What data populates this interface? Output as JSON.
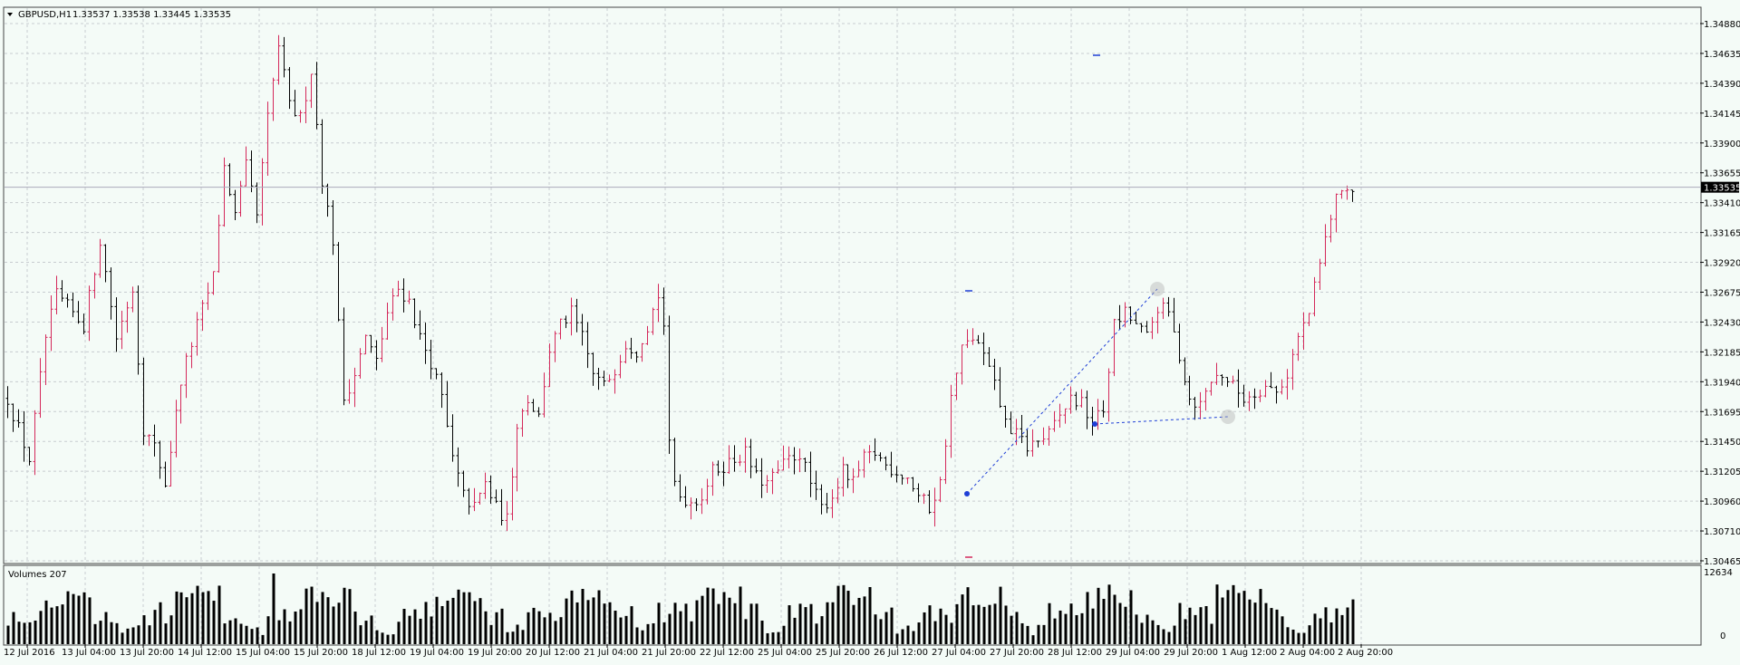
{
  "window": {
    "symbol_title": "GBPUSD,H1",
    "ohlc_text": "1.33537 1.33538 1.33445 1.33535",
    "menu_icon": "triangle-down-icon"
  },
  "colors": {
    "background": "#f4fbf7",
    "grid": "#c7ccd0",
    "bull_bar": "#d4285a",
    "bear_bar": "#000000",
    "volume_bar": "#000000",
    "trendline": "#1f3fd6",
    "current_price_bg": "#000000",
    "current_price_fg": "#ffffff"
  },
  "chart_data": [
    {
      "type": "bar",
      "subtype": "ohlc",
      "symbol": "GBPUSD",
      "timeframe": "H1",
      "ylim": [
        1.30465,
        1.3494
      ],
      "y_ticks": [
        "1.34880",
        "1.34635",
        "1.34390",
        "1.34145",
        "1.33900",
        "1.33655",
        "1.33410",
        "1.33165",
        "1.32920",
        "1.32675",
        "1.32430",
        "1.32185",
        "1.31940",
        "1.31695",
        "1.31450",
        "1.31205",
        "1.30960",
        "1.30710",
        "1.30465"
      ],
      "current_price": "1.33535",
      "x_labels": [
        "12 Jul 2016",
        "13 Jul 04:00",
        "13 Jul 20:00",
        "14 Jul 12:00",
        "15 Jul 04:00",
        "15 Jul 20:00",
        "18 Jul 12:00",
        "19 Jul 04:00",
        "19 Jul 20:00",
        "20 Jul 12:00",
        "21 Jul 04:00",
        "21 Jul 20:00",
        "22 Jul 12:00",
        "25 Jul 04:00",
        "25 Jul 20:00",
        "26 Jul 12:00",
        "27 Jul 04:00",
        "27 Jul 20:00",
        "28 Jul 12:00",
        "29 Jul 04:00",
        "29 Jul 20:00",
        "1 Aug 12:00",
        "2 Aug 04:00",
        "2 Aug 20:00"
      ],
      "price_path": [
        [
          0,
          1.318
        ],
        [
          4,
          1.313
        ],
        [
          7,
          1.323
        ],
        [
          9,
          1.3265
        ],
        [
          12,
          1.325
        ],
        [
          14,
          1.324
        ],
        [
          17,
          1.331
        ],
        [
          20,
          1.323
        ],
        [
          23,
          1.327
        ],
        [
          25,
          1.3155
        ],
        [
          27,
          1.314
        ],
        [
          29,
          1.311
        ],
        [
          32,
          1.3195
        ],
        [
          35,
          1.324
        ],
        [
          38,
          1.328
        ],
        [
          40,
          1.337
        ],
        [
          42,
          1.333
        ],
        [
          44,
          1.337
        ],
        [
          46,
          1.333
        ],
        [
          48,
          1.341
        ],
        [
          50,
          1.347
        ],
        [
          52,
          1.342
        ],
        [
          54,
          1.341
        ],
        [
          56,
          1.345
        ],
        [
          58,
          1.336
        ],
        [
          60,
          1.331
        ],
        [
          61,
          1.324
        ],
        [
          62,
          1.318
        ],
        [
          64,
          1.32
        ],
        [
          66,
          1.323
        ],
        [
          68,
          1.321
        ],
        [
          70,
          1.325
        ],
        [
          72,
          1.327
        ],
        [
          74,
          1.326
        ],
        [
          76,
          1.323
        ],
        [
          78,
          1.321
        ],
        [
          80,
          1.318
        ],
        [
          82,
          1.313
        ],
        [
          84,
          1.31
        ],
        [
          86,
          1.309
        ],
        [
          88,
          1.311
        ],
        [
          90,
          1.309
        ],
        [
          92,
          1.308
        ],
        [
          94,
          1.316
        ],
        [
          96,
          1.318
        ],
        [
          98,
          1.3165
        ],
        [
          100,
          1.322
        ],
        [
          102,
          1.324
        ],
        [
          104,
          1.325
        ],
        [
          106,
          1.323
        ],
        [
          108,
          1.32
        ],
        [
          110,
          1.319
        ],
        [
          112,
          1.3205
        ],
        [
          114,
          1.3225
        ],
        [
          116,
          1.322
        ],
        [
          118,
          1.324
        ],
        [
          120,
          1.3265
        ],
        [
          121,
          1.324
        ],
        [
          122,
          1.314
        ],
        [
          123,
          1.311
        ],
        [
          124,
          1.31
        ],
        [
          126,
          1.3095
        ],
        [
          128,
          1.31
        ],
        [
          130,
          1.312
        ],
        [
          132,
          1.3125
        ],
        [
          134,
          1.313
        ],
        [
          136,
          1.3135
        ],
        [
          138,
          1.3115
        ],
        [
          140,
          1.311
        ],
        [
          142,
          1.312
        ],
        [
          144,
          1.313
        ],
        [
          146,
          1.3135
        ],
        [
          148,
          1.311
        ],
        [
          150,
          1.309
        ],
        [
          152,
          1.31
        ],
        [
          154,
          1.312
        ],
        [
          156,
          1.311
        ],
        [
          158,
          1.313
        ],
        [
          160,
          1.3135
        ],
        [
          162,
          1.3125
        ],
        [
          164,
          1.312
        ],
        [
          166,
          1.3115
        ],
        [
          168,
          1.31
        ],
        [
          170,
          1.309
        ],
        [
          172,
          1.311
        ],
        [
          174,
          1.318
        ],
        [
          176,
          1.322
        ],
        [
          178,
          1.323
        ],
        [
          180,
          1.3215
        ],
        [
          182,
          1.319
        ],
        [
          184,
          1.316
        ],
        [
          186,
          1.315
        ],
        [
          188,
          1.314
        ],
        [
          190,
          1.3145
        ],
        [
          192,
          1.315
        ],
        [
          194,
          1.3165
        ],
        [
          196,
          1.318
        ],
        [
          198,
          1.3175
        ],
        [
          200,
          1.316
        ],
        [
          202,
          1.317
        ],
        [
          204,
          1.324
        ],
        [
          206,
          1.325
        ],
        [
          208,
          1.324
        ],
        [
          210,
          1.323
        ],
        [
          212,
          1.3255
        ],
        [
          214,
          1.325
        ],
        [
          216,
          1.3215
        ],
        [
          218,
          1.318
        ],
        [
          220,
          1.3175
        ],
        [
          222,
          1.3195
        ],
        [
          224,
          1.32
        ],
        [
          226,
          1.319
        ],
        [
          228,
          1.318
        ],
        [
          230,
          1.3185
        ],
        [
          232,
          1.319
        ],
        [
          234,
          1.3185
        ],
        [
          236,
          1.32
        ],
        [
          238,
          1.323
        ],
        [
          240,
          1.325
        ],
        [
          242,
          1.329
        ],
        [
          244,
          1.333
        ],
        [
          246,
          1.3355
        ],
        [
          248,
          1.335
        ]
      ],
      "series": [
        {
          "name": "Volumes 207",
          "type": "bar",
          "ylim": [
            0,
            12634
          ],
          "y_ticks": [
            "12634",
            "0"
          ]
        }
      ]
    }
  ]
}
